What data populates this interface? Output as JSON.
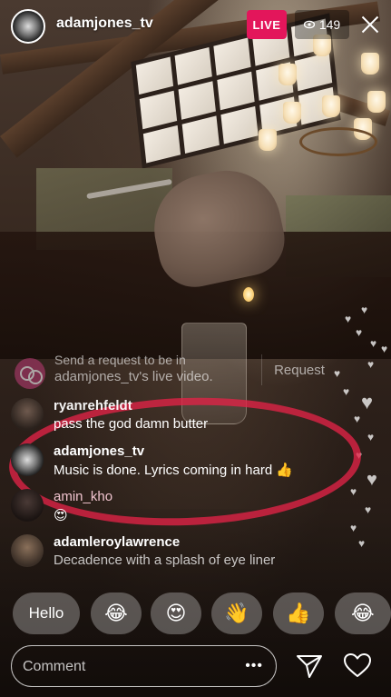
{
  "header": {
    "host_username": "adamjones_tv",
    "live_label": "LIVE",
    "viewer_count": "149"
  },
  "request": {
    "line1": "Send a request to be in",
    "line2": "adamjones_tv's live video.",
    "button_label": "Request"
  },
  "comments": [
    {
      "username": "ryanrehfeldt",
      "message": "pass the god damn butter"
    },
    {
      "username": "adamjones_tv",
      "message": "Music is done. Lyrics coming in hard 👍"
    },
    {
      "username": "amin_kho",
      "message": "😍"
    },
    {
      "username": "adamleroylawrence",
      "message": "Decadence with a splash of eye liner"
    }
  ],
  "quick_replies": [
    "Hello",
    "😂",
    "😍",
    "👋",
    "👍",
    "😂"
  ],
  "composer": {
    "placeholder": "Comment",
    "more_label": "•••"
  },
  "icons": {
    "viewers": "eye-icon",
    "close": "close-icon",
    "send": "send-icon",
    "like": "heart-icon"
  },
  "colors": {
    "live_badge": "#e3165b",
    "annotation_circle": "#e12346"
  }
}
